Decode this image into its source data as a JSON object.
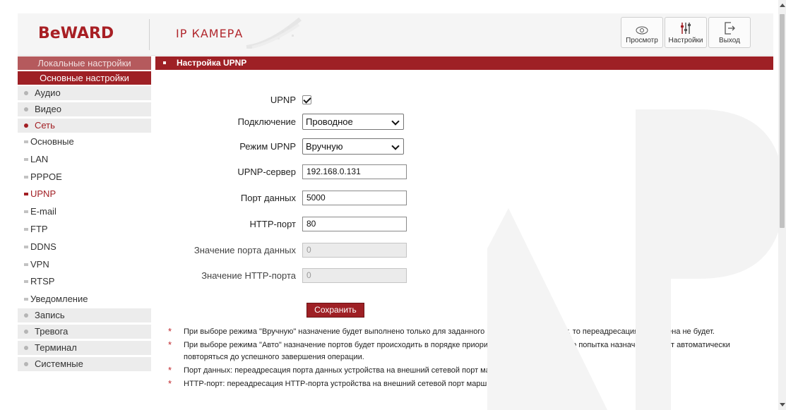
{
  "header": {
    "logo": "BeWARD",
    "subtitle": "IP КАМЕРА",
    "toolbar": [
      {
        "label": "Просмотр",
        "icon": "eye-icon"
      },
      {
        "label": "Настройки",
        "icon": "sliders-icon"
      },
      {
        "label": "Выход",
        "icon": "exit-icon"
      }
    ]
  },
  "sidebar": {
    "local_settings": "Локальные настройки",
    "main_settings": "Основные настройки",
    "sections": [
      {
        "label": "Аудио"
      },
      {
        "label": "Видео"
      },
      {
        "label": "Сеть",
        "active": true
      }
    ],
    "network_items": [
      {
        "label": "Основные"
      },
      {
        "label": "LAN"
      },
      {
        "label": "PPPOE"
      },
      {
        "label": "UPNP",
        "active": true
      },
      {
        "label": "E-mail"
      },
      {
        "label": "FTP"
      },
      {
        "label": "DDNS"
      },
      {
        "label": "VPN"
      },
      {
        "label": "RTSP"
      },
      {
        "label": "Уведомление"
      }
    ],
    "sections_after": [
      {
        "label": "Запись"
      },
      {
        "label": "Тревога"
      },
      {
        "label": "Терминал"
      },
      {
        "label": "Системные"
      }
    ]
  },
  "main": {
    "title": "Настройка UPNP",
    "form": {
      "upnp_label": "UPNP",
      "upnp_checked": true,
      "connection_label": "Подключение",
      "connection_value": "Проводное",
      "mode_label": "Режим UPNP",
      "mode_value": "Вручную",
      "server_label": "UPNP-сервер",
      "server_value": "192.168.0.131",
      "data_port_label": "Порт данных",
      "data_port_value": "5000",
      "http_port_label": "HTTP-порт",
      "http_port_value": "80",
      "data_port_status_label": "Значение порта данных",
      "data_port_status_value": "0",
      "http_port_status_label": "Значение HTTP-порта",
      "http_port_status_value": "0"
    },
    "save_label": "Сохранить",
    "notes": [
      "При выборе режима \"Вручную\" назначение будет выполнено только для заданного порта, если порт занят, то переадресация выполнена не будет.",
      "При выборе режима \"Авто\" назначение портов будет происходить в порядке приоритета; если порт занят, то попытка назначения будет автоматически повторяться до успешного завершения операции.",
      "Порт данных: переадресация порта данных устройства на внешний сетевой порт маршрутизатора.",
      "HTTP-порт: переадресация HTTP-порта устройства на внешний сетевой порт маршрутизатора."
    ]
  },
  "colors": {
    "brand": "#9e2025",
    "brand_light": "#b55a5d",
    "nav_bg": "#ececec"
  }
}
